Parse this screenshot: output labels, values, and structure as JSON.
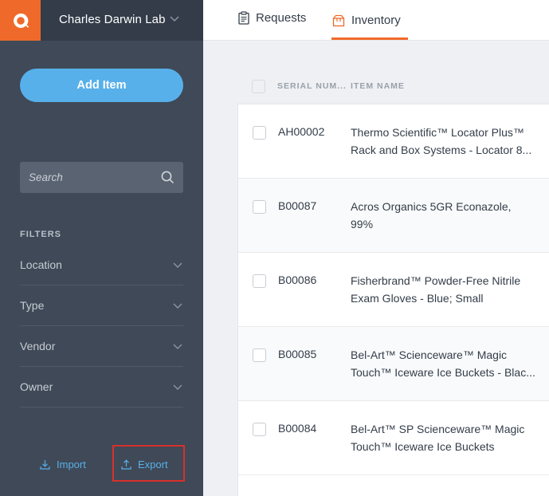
{
  "app": {
    "lab_name": "Charles Darwin Lab"
  },
  "sidebar": {
    "add_item_label": "Add Item",
    "search_placeholder": "Search",
    "filters_title": "FILTERS",
    "filters": [
      {
        "label": "Location"
      },
      {
        "label": "Type"
      },
      {
        "label": "Vendor"
      },
      {
        "label": "Owner"
      }
    ],
    "import_label": "Import",
    "export_label": "Export"
  },
  "nav": {
    "tabs": [
      {
        "label": "Requests",
        "active": false
      },
      {
        "label": "Inventory",
        "active": true
      }
    ]
  },
  "table": {
    "columns": [
      "SERIAL NUM...",
      "ITEM NAME"
    ],
    "rows": [
      {
        "serial": "AH00002",
        "name_line1": "Thermo Scientific™ Locator Plus™",
        "name_line2": "Rack and Box Systems - Locator 8..."
      },
      {
        "serial": "B00087",
        "name_line1": "Acros Organics 5GR Econazole,",
        "name_line2": "99%"
      },
      {
        "serial": "B00086",
        "name_line1": "Fisherbrand™ Powder-Free Nitrile",
        "name_line2": "Exam Gloves - Blue; Small"
      },
      {
        "serial": "B00085",
        "name_line1": "Bel-Art™ Scienceware™ Magic",
        "name_line2": "Touch™ Iceware Ice Buckets - Blac..."
      },
      {
        "serial": "B00084",
        "name_line1": "Bel-Art™ SP Scienceware™ Magic",
        "name_line2": "Touch™ Iceware Ice Buckets"
      }
    ]
  },
  "colors": {
    "brand_orange": "#ef6a2a",
    "accent_blue": "#57b0e9",
    "sidebar_bg": "#3f4957",
    "highlight_red": "#d9302c"
  },
  "icons": {
    "logo": "q-logo-icon",
    "lab_dropdown": "chevron-down-icon",
    "search": "search-icon",
    "filter_expand": "chevron-down-icon",
    "import": "download-icon",
    "export": "upload-icon",
    "requests": "clipboard-icon",
    "inventory": "box-icon"
  }
}
